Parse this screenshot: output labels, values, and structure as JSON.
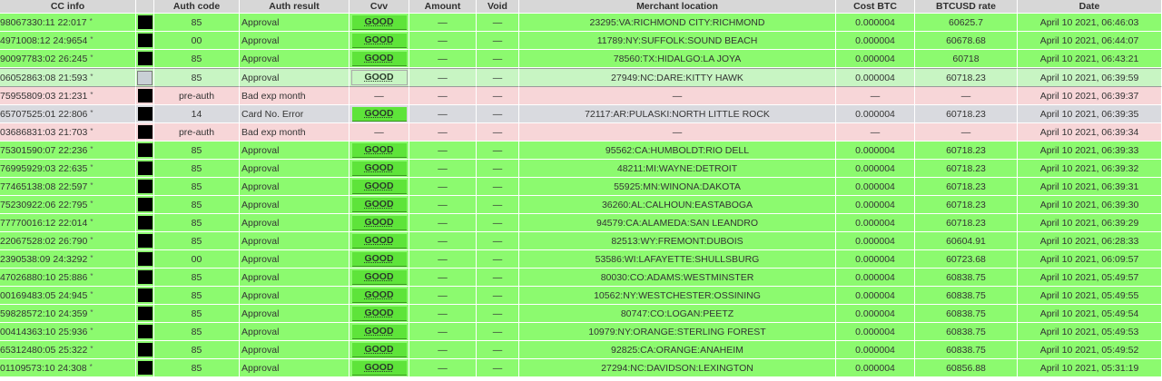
{
  "headers": [
    "CC info",
    "",
    "Auth code",
    "Auth result",
    "Cvv",
    "Amount",
    "Void",
    "Merchant location",
    "Cost BTC",
    "BTCUSD rate",
    "Date"
  ],
  "rows": [
    {
      "style": "green",
      "cc": "98067330:11 22:017",
      "star": "*",
      "auth_code": "85",
      "auth_result": "Approval",
      "cvv": "GOOD",
      "amount": "—",
      "void": "—",
      "location": "23295:VA:RICHMOND CITY:RICHMOND",
      "cost_btc": "0.000004",
      "rate": "60625.7",
      "date": "April 10 2021, 06:46:03"
    },
    {
      "style": "green",
      "cc": "4971008:12 24:9654",
      "star": "*",
      "auth_code": "00",
      "auth_result": "Approval",
      "cvv": "GOOD",
      "amount": "—",
      "void": "—",
      "location": "11789:NY:SUFFOLK:SOUND BEACH",
      "cost_btc": "0.000004",
      "rate": "60678.68",
      "date": "April 10 2021, 06:44:07"
    },
    {
      "style": "green",
      "cc": "90097783:02 26:245",
      "star": "*",
      "auth_code": "85",
      "auth_result": "Approval",
      "cvv": "GOOD",
      "amount": "—",
      "void": "—",
      "location": "78560:TX:HIDALGO:LA JOYA",
      "cost_btc": "0.000004",
      "rate": "60718",
      "date": "April 10 2021, 06:43:21"
    },
    {
      "style": "light sel",
      "cc": "06052863:08 21:593",
      "star": "*",
      "auth_code": "85",
      "auth_result": "Approval",
      "cvv": "GOOD",
      "amount": "—",
      "void": "—",
      "location": "27949:NC:DARE:KITTY HAWK",
      "cost_btc": "0.000004",
      "rate": "60718.23",
      "date": "April 10 2021, 06:39:59"
    },
    {
      "style": "pink",
      "cc": "75955809:03 21:231",
      "star": "*",
      "auth_code": "pre-auth",
      "auth_result": "Bad exp month",
      "cvv": "—",
      "amount": "—",
      "void": "—",
      "location": "—",
      "cost_btc": "—",
      "rate": "—",
      "date": "April 10 2021, 06:39:37"
    },
    {
      "style": "grey",
      "cc": "65707525:01 22:806",
      "star": "*",
      "auth_code": "14",
      "auth_result": "Card No. Error",
      "cvv": "GOOD",
      "amount": "—",
      "void": "—",
      "location": "72117:AR:PULASKI:NORTH LITTLE ROCK",
      "cost_btc": "0.000004",
      "rate": "60718.23",
      "date": "April 10 2021, 06:39:35"
    },
    {
      "style": "pink",
      "cc": "03686831:03 21:703",
      "star": "*",
      "auth_code": "pre-auth",
      "auth_result": "Bad exp month",
      "cvv": "—",
      "amount": "—",
      "void": "—",
      "location": "—",
      "cost_btc": "—",
      "rate": "—",
      "date": "April 10 2021, 06:39:34"
    },
    {
      "style": "green",
      "cc": "75301590:07 22:236",
      "star": "*",
      "auth_code": "85",
      "auth_result": "Approval",
      "cvv": "GOOD",
      "amount": "—",
      "void": "—",
      "location": "95562:CA:HUMBOLDT:RIO DELL",
      "cost_btc": "0.000004",
      "rate": "60718.23",
      "date": "April 10 2021, 06:39:33"
    },
    {
      "style": "green",
      "cc": "76995929:03 22:635",
      "star": "*",
      "auth_code": "85",
      "auth_result": "Approval",
      "cvv": "GOOD",
      "amount": "—",
      "void": "—",
      "location": "48211:MI:WAYNE:DETROIT",
      "cost_btc": "0.000004",
      "rate": "60718.23",
      "date": "April 10 2021, 06:39:32"
    },
    {
      "style": "green",
      "cc": "77465138:08 22:597",
      "star": "*",
      "auth_code": "85",
      "auth_result": "Approval",
      "cvv": "GOOD",
      "amount": "—",
      "void": "—",
      "location": "55925:MN:WINONA:DAKOTA",
      "cost_btc": "0.000004",
      "rate": "60718.23",
      "date": "April 10 2021, 06:39:31"
    },
    {
      "style": "green",
      "cc": "75230922:06 22:795",
      "star": "*",
      "auth_code": "85",
      "auth_result": "Approval",
      "cvv": "GOOD",
      "amount": "—",
      "void": "—",
      "location": "36260:AL:CALHOUN:EASTABOGA",
      "cost_btc": "0.000004",
      "rate": "60718.23",
      "date": "April 10 2021, 06:39:30"
    },
    {
      "style": "green",
      "cc": "77770016:12 22:014",
      "star": "*",
      "auth_code": "85",
      "auth_result": "Approval",
      "cvv": "GOOD",
      "amount": "—",
      "void": "—",
      "location": "94579:CA:ALAMEDA:SAN LEANDRO",
      "cost_btc": "0.000004",
      "rate": "60718.23",
      "date": "April 10 2021, 06:39:29"
    },
    {
      "style": "green",
      "cc": "22067528:02 26:790",
      "star": "*",
      "auth_code": "85",
      "auth_result": "Approval",
      "cvv": "GOOD",
      "amount": "—",
      "void": "—",
      "location": "82513:WY:FREMONT:DUBOIS",
      "cost_btc": "0.000004",
      "rate": "60604.91",
      "date": "April 10 2021, 06:28:33"
    },
    {
      "style": "green",
      "cc": "2390538:09 24:3292",
      "star": "*",
      "auth_code": "00",
      "auth_result": "Approval",
      "cvv": "GOOD",
      "amount": "—",
      "void": "—",
      "location": "53586:WI:LAFAYETTE:SHULLSBURG",
      "cost_btc": "0.000004",
      "rate": "60723.68",
      "date": "April 10 2021, 06:09:57"
    },
    {
      "style": "green",
      "cc": "47026880:10 25:886",
      "star": "*",
      "auth_code": "85",
      "auth_result": "Approval",
      "cvv": "GOOD",
      "amount": "—",
      "void": "—",
      "location": "80030:CO:ADAMS:WESTMINSTER",
      "cost_btc": "0.000004",
      "rate": "60838.75",
      "date": "April 10 2021, 05:49:57"
    },
    {
      "style": "green",
      "cc": "00169483:05 24:945",
      "star": "*",
      "auth_code": "85",
      "auth_result": "Approval",
      "cvv": "GOOD",
      "amount": "—",
      "void": "—",
      "location": "10562:NY:WESTCHESTER:OSSINING",
      "cost_btc": "0.000004",
      "rate": "60838.75",
      "date": "April 10 2021, 05:49:55"
    },
    {
      "style": "green",
      "cc": "59828572:10 24:359",
      "star": "*",
      "auth_code": "85",
      "auth_result": "Approval",
      "cvv": "GOOD",
      "amount": "—",
      "void": "—",
      "location": "80747:CO:LOGAN:PEETZ",
      "cost_btc": "0.000004",
      "rate": "60838.75",
      "date": "April 10 2021, 05:49:54"
    },
    {
      "style": "green",
      "cc": "00414363:10 25:936",
      "star": "*",
      "auth_code": "85",
      "auth_result": "Approval",
      "cvv": "GOOD",
      "amount": "—",
      "void": "—",
      "location": "10979:NY:ORANGE:STERLING FOREST",
      "cost_btc": "0.000004",
      "rate": "60838.75",
      "date": "April 10 2021, 05:49:53"
    },
    {
      "style": "green",
      "cc": "65312480:05 25:322",
      "star": "*",
      "auth_code": "85",
      "auth_result": "Approval",
      "cvv": "GOOD",
      "amount": "—",
      "void": "—",
      "location": "92825:CA:ORANGE:ANAHEIM",
      "cost_btc": "0.000004",
      "rate": "60838.75",
      "date": "April 10 2021, 05:49:52"
    },
    {
      "style": "green",
      "cc": "01109573:10 24:308",
      "star": "*",
      "auth_code": "85",
      "auth_result": "Approval",
      "cvv": "GOOD",
      "amount": "—",
      "void": "—",
      "location": "27294:NC:DAVIDSON:LEXINGTON",
      "cost_btc": "0.000004",
      "rate": "60856.88",
      "date": "April 10 2021, 05:31:19"
    }
  ]
}
